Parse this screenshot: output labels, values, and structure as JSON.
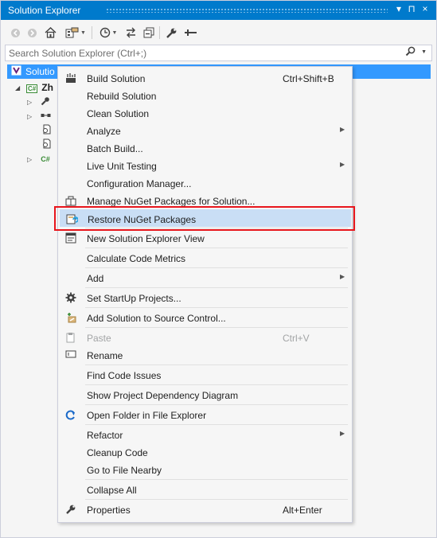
{
  "window": {
    "title": "Solution Explorer",
    "pin_glyph": "▾",
    "autohide_glyph": "⊓",
    "close_glyph": "×"
  },
  "toolbar": {
    "icons": [
      "back-icon",
      "forward-icon",
      "home-icon",
      "switch-views-icon",
      "pending-changes-filter-icon",
      "sync-icon",
      "collapse-all-icon",
      "properties-icon",
      "preview-icon"
    ]
  },
  "search": {
    "placeholder": "Search Solution Explorer (Ctrl+;)"
  },
  "tree": {
    "solution_label": "Solutio",
    "project_label": "Zh"
  },
  "menu": {
    "items": [
      {
        "label": "Build Solution",
        "shortcut": "Ctrl+Shift+B",
        "icon": "build-icon"
      },
      {
        "label": "Rebuild Solution"
      },
      {
        "label": "Clean Solution"
      },
      {
        "label": "Analyze",
        "submenu": true
      },
      {
        "label": "Batch Build..."
      },
      {
        "label": "Live Unit Testing",
        "submenu": true
      },
      {
        "label": "Configuration Manager..."
      },
      {
        "label": "Manage NuGet Packages for Solution...",
        "icon": "nuget-icon"
      },
      {
        "label": "Restore NuGet Packages",
        "icon": "restore-packages-icon",
        "highlighted": true
      },
      {
        "label": "New Solution Explorer View",
        "icon": "new-view-icon"
      },
      {
        "label": "Calculate Code Metrics"
      },
      {
        "label": "Add",
        "submenu": true
      },
      {
        "label": "Set StartUp Projects...",
        "icon": "gear-icon"
      },
      {
        "label": "Add Solution to Source Control...",
        "icon": "source-control-icon"
      },
      {
        "label": "Paste",
        "shortcut": "Ctrl+V",
        "icon": "paste-icon",
        "disabled": true
      },
      {
        "label": "Rename",
        "icon": "rename-icon"
      },
      {
        "label": "Find Code Issues"
      },
      {
        "label": "Show Project Dependency Diagram"
      },
      {
        "label": "Open Folder in File Explorer",
        "icon": "open-folder-icon"
      },
      {
        "label": "Refactor",
        "submenu": true
      },
      {
        "label": "Cleanup Code"
      },
      {
        "label": "Go to File Nearby"
      },
      {
        "label": "Collapse All"
      },
      {
        "label": "Properties",
        "shortcut": "Alt+Enter",
        "icon": "wrench-icon"
      }
    ]
  },
  "colors": {
    "accent": "#007acc",
    "selection": "#3399ff",
    "menu_highlight": "#c9def5",
    "callout_border": "#e8151c"
  }
}
